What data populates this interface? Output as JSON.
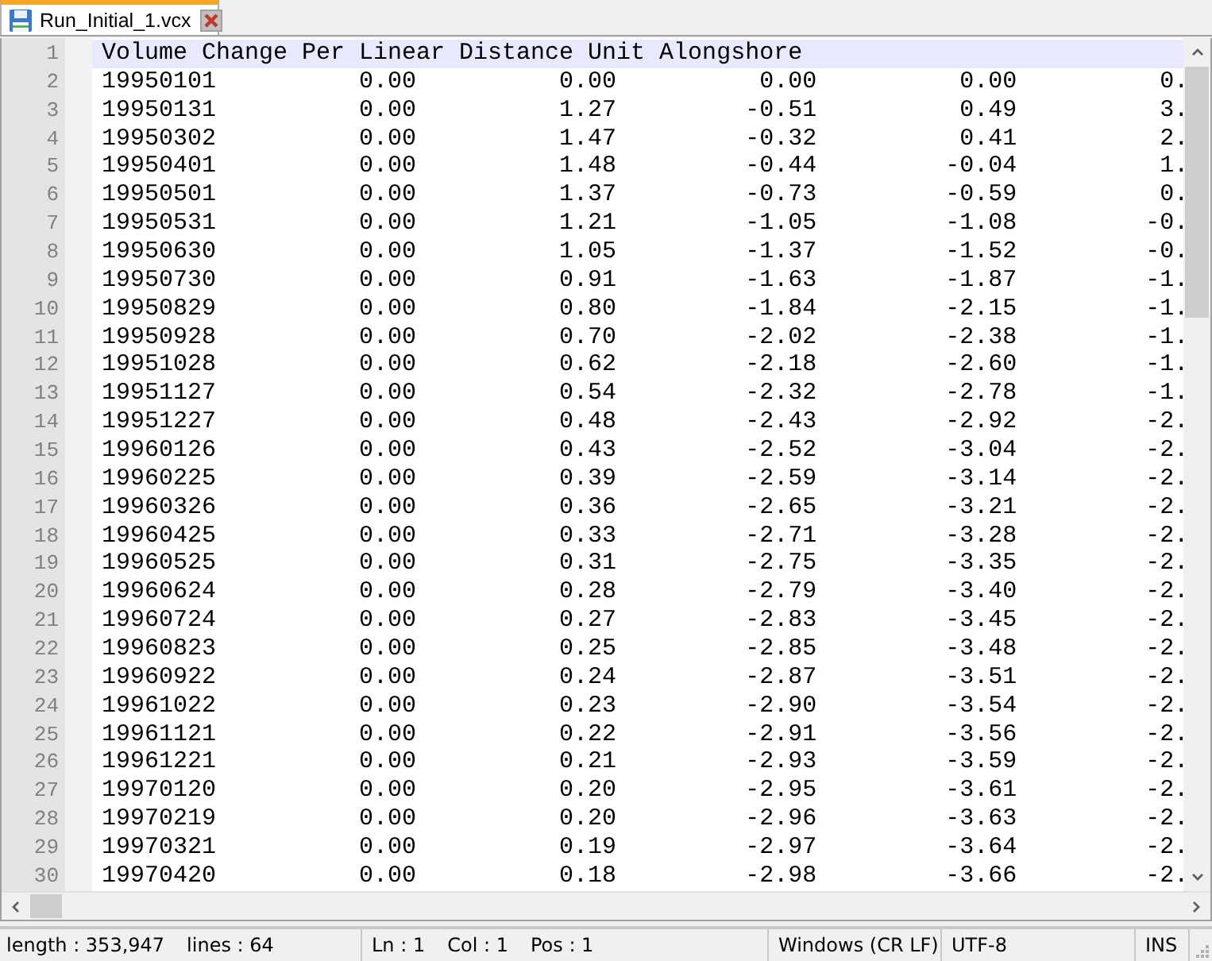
{
  "tabs": [
    {
      "label": "Run_Initial_1.vcx",
      "selected": true
    }
  ],
  "editor": {
    "lines": [
      {
        "number": "1",
        "text": "Volume Change Per Linear Distance Unit Alongshore",
        "current": true
      },
      {
        "number": "2",
        "text": "19950101          0.00          0.00          0.00          0.00          0.",
        "current": false
      },
      {
        "number": "3",
        "text": "19950131          0.00          1.27         -0.51          0.49          3.",
        "current": false
      },
      {
        "number": "4",
        "text": "19950302          0.00          1.47         -0.32          0.41          2.",
        "current": false
      },
      {
        "number": "5",
        "text": "19950401          0.00          1.48         -0.44         -0.04          1.",
        "current": false
      },
      {
        "number": "6",
        "text": "19950501          0.00          1.37         -0.73         -0.59          0.",
        "current": false
      },
      {
        "number": "7",
        "text": "19950531          0.00          1.21         -1.05         -1.08         -0.",
        "current": false
      },
      {
        "number": "8",
        "text": "19950630          0.00          1.05         -1.37         -1.52         -0.",
        "current": false
      },
      {
        "number": "9",
        "text": "19950730          0.00          0.91         -1.63         -1.87         -1.",
        "current": false
      },
      {
        "number": "10",
        "text": "19950829          0.00          0.80         -1.84         -2.15         -1.",
        "current": false
      },
      {
        "number": "11",
        "text": "19950928          0.00          0.70         -2.02         -2.38         -1.",
        "current": false
      },
      {
        "number": "12",
        "text": "19951028          0.00          0.62         -2.18         -2.60         -1.",
        "current": false
      },
      {
        "number": "13",
        "text": "19951127          0.00          0.54         -2.32         -2.78         -1.",
        "current": false
      },
      {
        "number": "14",
        "text": "19951227          0.00          0.48         -2.43         -2.92         -2.",
        "current": false
      },
      {
        "number": "15",
        "text": "19960126          0.00          0.43         -2.52         -3.04         -2.",
        "current": false
      },
      {
        "number": "16",
        "text": "19960225          0.00          0.39         -2.59         -3.14         -2.",
        "current": false
      },
      {
        "number": "17",
        "text": "19960326          0.00          0.36         -2.65         -3.21         -2.",
        "current": false
      },
      {
        "number": "18",
        "text": "19960425          0.00          0.33         -2.71         -3.28         -2.",
        "current": false
      },
      {
        "number": "19",
        "text": "19960525          0.00          0.31         -2.75         -3.35         -2.",
        "current": false
      },
      {
        "number": "20",
        "text": "19960624          0.00          0.28         -2.79         -3.40         -2.",
        "current": false
      },
      {
        "number": "21",
        "text": "19960724          0.00          0.27         -2.83         -3.45         -2.",
        "current": false
      },
      {
        "number": "22",
        "text": "19960823          0.00          0.25         -2.85         -3.48         -2.",
        "current": false
      },
      {
        "number": "23",
        "text": "19960922          0.00          0.24         -2.87         -3.51         -2.",
        "current": false
      },
      {
        "number": "24",
        "text": "19961022          0.00          0.23         -2.90         -3.54         -2.",
        "current": false
      },
      {
        "number": "25",
        "text": "19961121          0.00          0.22         -2.91         -3.56         -2.",
        "current": false
      },
      {
        "number": "26",
        "text": "19961221          0.00          0.21         -2.93         -3.59         -2.",
        "current": false
      },
      {
        "number": "27",
        "text": "19970120          0.00          0.20         -2.95         -3.61         -2.",
        "current": false
      },
      {
        "number": "28",
        "text": "19970219          0.00          0.20         -2.96         -3.63         -2.",
        "current": false
      },
      {
        "number": "29",
        "text": "19970321          0.00          0.19         -2.97         -3.64         -2.",
        "current": false
      },
      {
        "number": "30",
        "text": "19970420          0.00          0.18         -2.98         -3.66         -2.",
        "current": false
      }
    ]
  },
  "status_bar": {
    "sections": [
      {
        "items": [
          "length : 353,947",
          "lines : 64"
        ]
      },
      {
        "items": [
          "Ln : 1",
          "Col : 1",
          "Pos : 1"
        ]
      },
      {
        "items": [
          "Windows (CR LF)"
        ]
      },
      {
        "items": [
          "UTF-8"
        ]
      },
      {
        "items": [
          "INS"
        ]
      }
    ]
  }
}
